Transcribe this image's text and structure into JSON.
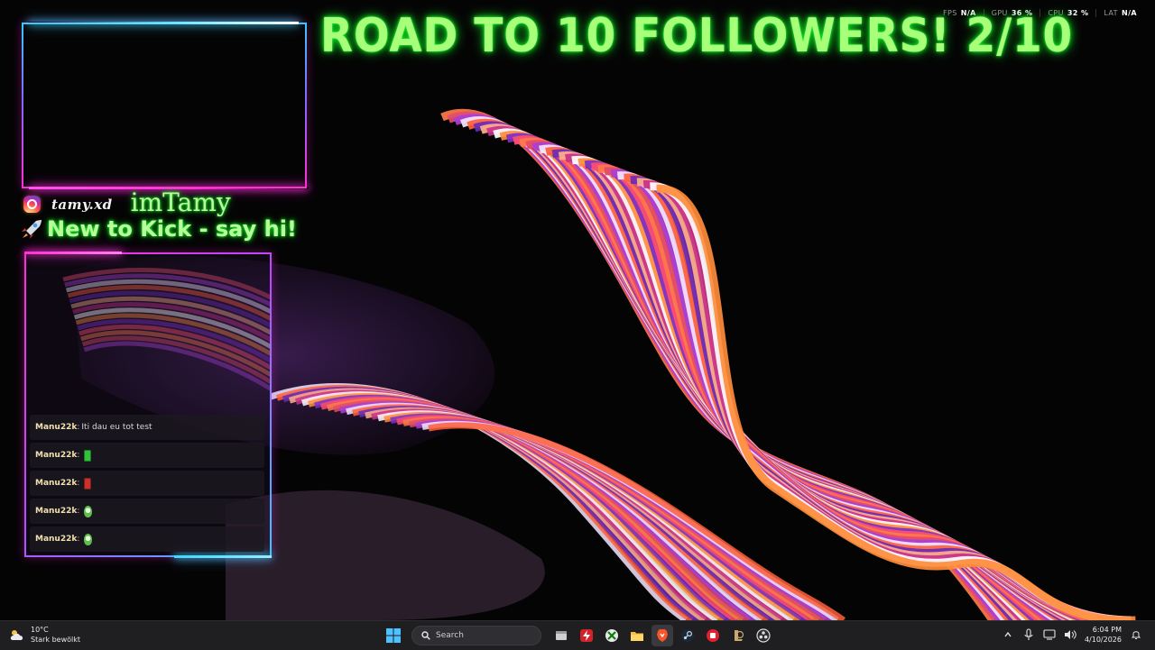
{
  "overlay": {
    "headline": "ROAD TO 10 FOLLOWERS! 2/10",
    "social_handle": "tamy.xd",
    "streamer_name": "imTamy",
    "tagline": "New to Kick - say hi!"
  },
  "stats": [
    {
      "label": "FPS",
      "value": "N/A"
    },
    {
      "label": "GPU",
      "value": "36 %"
    },
    {
      "label": "CPU",
      "value": "32 %"
    },
    {
      "label": "LAT",
      "value": "N/A"
    }
  ],
  "chat": {
    "messages": [
      {
        "user": "Manu22k",
        "sep": ":",
        "text": "Iti dau eu tot test",
        "emote": ""
      },
      {
        "user": "Manu22k",
        "sep": ":",
        "text": "",
        "emote": "green"
      },
      {
        "user": "Manu22k",
        "sep": ":",
        "text": "",
        "emote": "red"
      },
      {
        "user": "Manu22k",
        "sep": ":",
        "text": "",
        "emote": "bean"
      },
      {
        "user": "Manu22k",
        "sep": ":",
        "text": "",
        "emote": "bean"
      }
    ]
  },
  "taskbar": {
    "weather_temp": "10°C",
    "weather_desc": "Stark bewölkt",
    "search_label": "Search",
    "apps": [
      "file-explorer-icon",
      "flash-app-icon",
      "xbox-icon",
      "folder-icon",
      "brave-icon",
      "steam-icon",
      "red-app-icon",
      "league-icon",
      "obs-icon"
    ],
    "clock_time": "6:04 PM",
    "clock_date": "4/10/2026"
  },
  "colors": {
    "neon_green": "#b8ff9c",
    "neon_pink": "#ff2fd6",
    "neon_cyan": "#3ac8ff",
    "taskbar_bg": "#1f1f22"
  }
}
